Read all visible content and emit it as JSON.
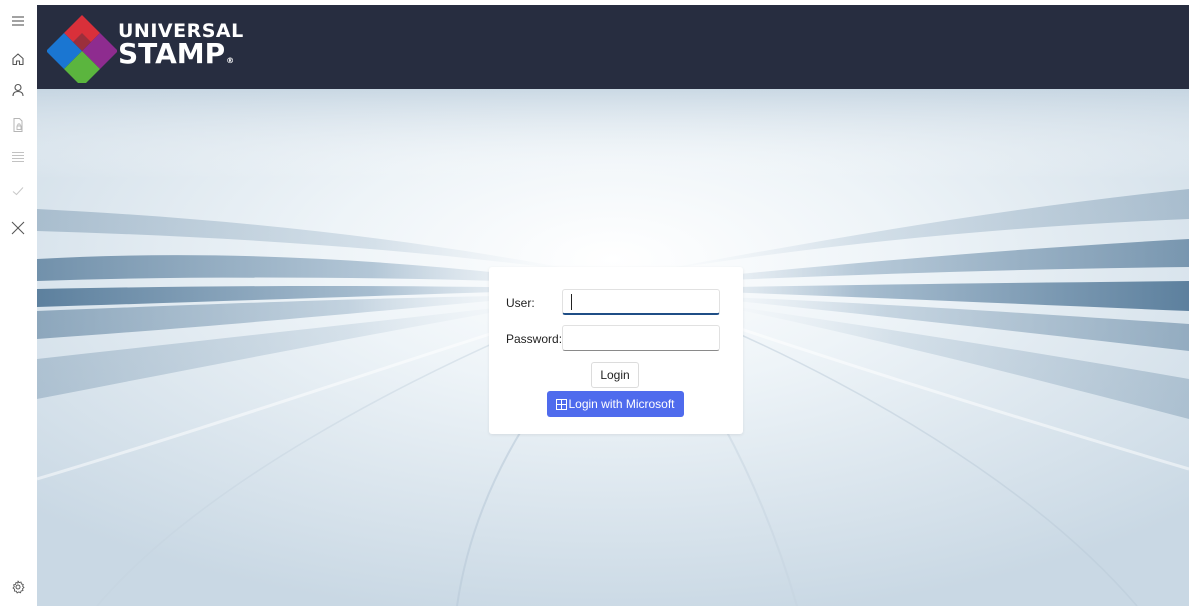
{
  "sidebar": {
    "items": [
      {
        "icon": "hamburger-icon",
        "enabled": true
      },
      {
        "icon": "home-icon",
        "enabled": true
      },
      {
        "icon": "person-icon",
        "enabled": true
      },
      {
        "icon": "document-lock-icon",
        "enabled": false
      },
      {
        "icon": "list-icon",
        "enabled": false
      },
      {
        "icon": "checkmark-icon",
        "enabled": false
      },
      {
        "icon": "close-icon",
        "enabled": true
      }
    ],
    "settings_icon": "gear-icon"
  },
  "header": {
    "logo": {
      "line1": "UNIVERSAL",
      "line2": "STAMP",
      "registered": "®"
    },
    "background_color": "#272d40"
  },
  "login": {
    "user_label": "User:",
    "user_value": "",
    "password_label": "Password:",
    "password_value": "",
    "login_button": "Login",
    "microsoft_button": "Login with Microsoft",
    "accent_color": "#4f6bed"
  }
}
